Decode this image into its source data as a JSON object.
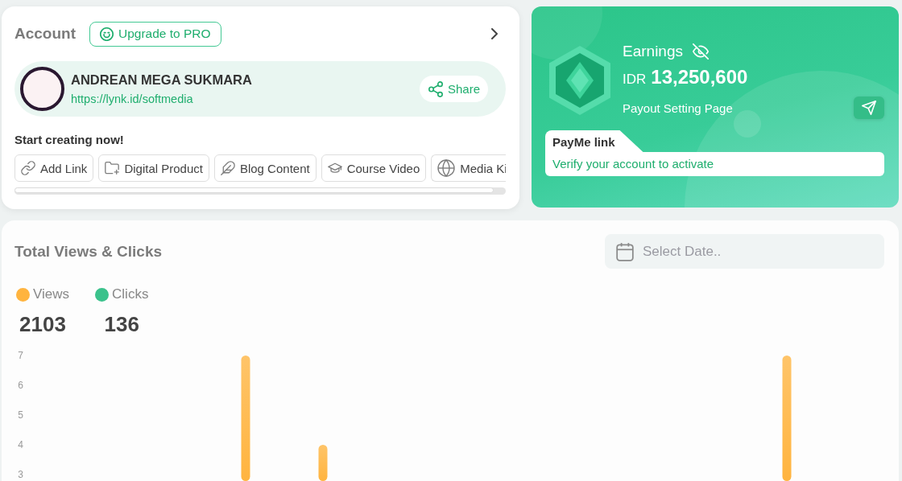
{
  "account": {
    "title": "Account",
    "upgrade_button": "Upgrade to PRO",
    "profile": {
      "name": "ANDREAN MEGA SUKMARA",
      "url": "https://lynk.id/softmedia",
      "share_button": "Share"
    },
    "create_heading": "Start creating now!",
    "create_options": [
      {
        "kind": "link",
        "label": "Add Link"
      },
      {
        "kind": "product",
        "label": "Digital Product"
      },
      {
        "kind": "blog",
        "label": "Blog Content"
      },
      {
        "kind": "course",
        "label": "Course Video"
      },
      {
        "kind": "media",
        "label": "Media Ki"
      }
    ]
  },
  "earnings": {
    "title": "Earnings",
    "currency": "IDR",
    "amount": "13,250,600",
    "payout_link": "Payout Setting Page",
    "payme": {
      "tab": "PayMe link",
      "message": "Verify your account to activate"
    }
  },
  "stats": {
    "title": "Total Views & Clicks",
    "date_field": {
      "placeholder": "Select Date.."
    },
    "legend": [
      {
        "label": "Views",
        "color": "#ffb43f",
        "total": "2103"
      },
      {
        "label": "Clicks",
        "color": "#3bc28c",
        "total": "136"
      }
    ],
    "y_axis_labels": [
      "7",
      "6",
      "5",
      "4",
      "3"
    ]
  }
}
